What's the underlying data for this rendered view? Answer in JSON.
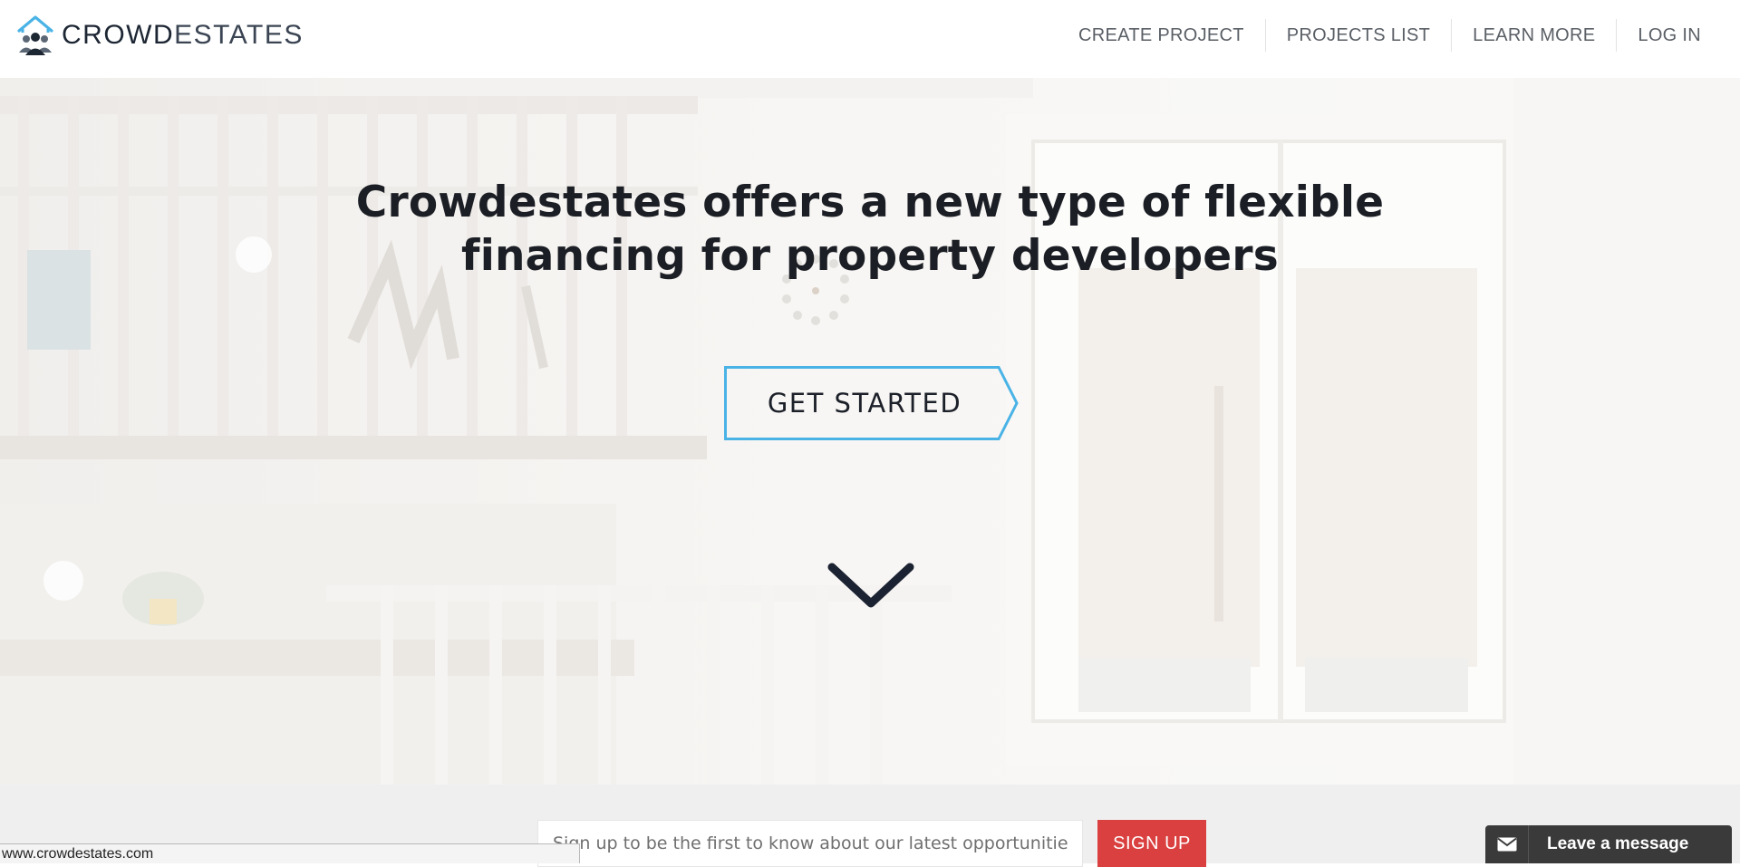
{
  "brand": {
    "name_bold": "CROWD",
    "name_light": "ESTATES"
  },
  "nav": {
    "items": [
      {
        "label": "CREATE PROJECT"
      },
      {
        "label": "PROJECTS LIST"
      },
      {
        "label": "LEARN MORE"
      },
      {
        "label": "LOG IN"
      }
    ]
  },
  "hero": {
    "title_line1": "Crowdestates offers a new type of flexible",
    "title_line2": "financing for property developers",
    "cta_label": "GET STARTED"
  },
  "signup": {
    "placeholder": "Sign up to be the first to know about our latest opportunities",
    "button_label": "SIGN UP"
  },
  "status_bar": {
    "url": "www.crowdestates.com"
  },
  "chat": {
    "label": "Leave a message"
  },
  "colors": {
    "accent_blue": "#4ab3e6",
    "signup_red": "#d9403f",
    "chat_dark": "#3a3a3a"
  }
}
